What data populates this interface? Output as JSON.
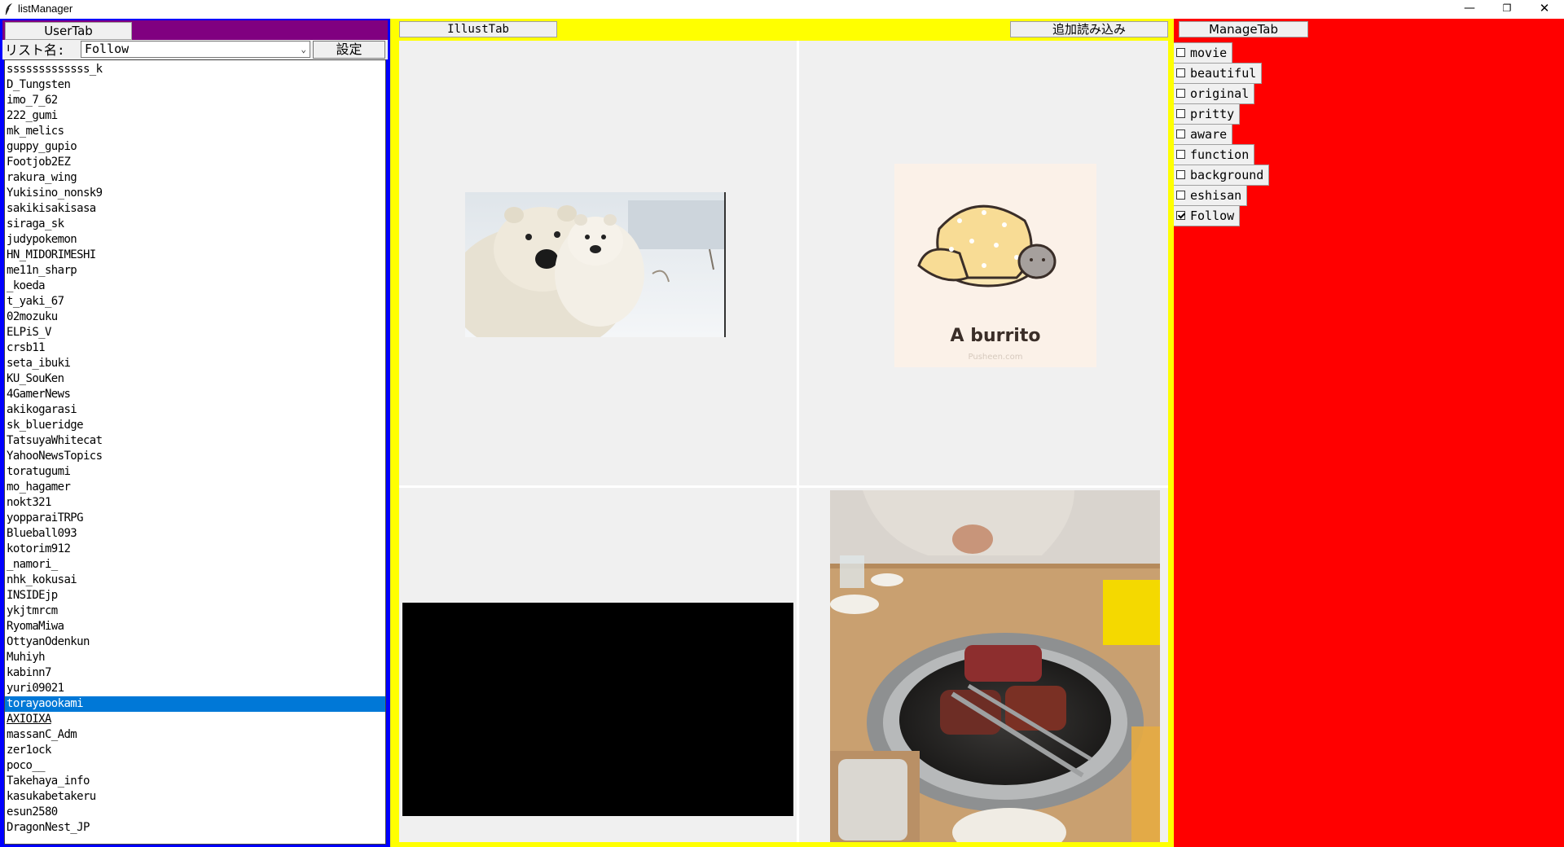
{
  "window": {
    "title": "listManager",
    "minimize": "—",
    "restore": "❐",
    "close": "✕"
  },
  "user_panel": {
    "tab_label": "UserTab",
    "list_label": "リスト名:",
    "list_selected": "Follow",
    "settings_label": "設定",
    "users": [
      "sssssssssssss_k",
      "D_Tungsten",
      "imo_7_62",
      "222_gumi",
      "mk_melics",
      "guppy_gupio",
      "Footjob2EZ",
      "rakura_wing",
      "Yukisino_nonsk9",
      "sakikisakisasa",
      "siraga_sk",
      "judypokemon",
      "HN_MIDORIMESHI",
      "me11n_sharp",
      "_koeda",
      "t_yaki_67",
      "02mozuku",
      "ELPiS_V",
      "crsb11",
      "seta_ibuki",
      "KU_SouKen",
      "4GamerNews",
      "akikogarasi",
      "sk_blueridge",
      "TatsuyaWhitecat",
      "YahooNewsTopics",
      "toratugumi",
      "mo_hagamer",
      "nokt321",
      "yopparaiTRPG",
      "Blueball093",
      "kotorim912",
      "_namori_",
      "nhk_kokusai",
      "INSIDEjp",
      "ykjtmrcm",
      "RyomaMiwa",
      "OttyanOdenkun",
      "Muhiyh",
      "kabinn7",
      "yuri09021",
      "torayaookami",
      "AXIOIXA",
      "massanC_Adm",
      "zer1ock",
      "poco__",
      "Takehaya_info",
      "kasukabetakeru",
      "esun2580",
      "DragonNest_JP"
    ],
    "selected_user": "torayaookami",
    "focused_user": "AXIOIXA"
  },
  "illust_panel": {
    "tab_label": "IllustTab",
    "load_more_label": "追加読み込み",
    "images": [
      {
        "name": "polar-bears-image",
        "caption": ""
      },
      {
        "name": "pusheen-burrito-image",
        "text": "A burrito",
        "credit": "Pusheen.com"
      },
      {
        "name": "black-video-thumbnail"
      },
      {
        "name": "yakiniku-grill-photo"
      }
    ]
  },
  "manage_panel": {
    "tab_label": "ManageTab",
    "tags": [
      {
        "label": "movie",
        "checked": false
      },
      {
        "label": "beautiful",
        "checked": false
      },
      {
        "label": "original",
        "checked": false
      },
      {
        "label": "pritty",
        "checked": false
      },
      {
        "label": "aware",
        "checked": false
      },
      {
        "label": "function",
        "checked": false
      },
      {
        "label": "background",
        "checked": false
      },
      {
        "label": "eshisan",
        "checked": false
      },
      {
        "label": "Follow",
        "checked": true
      }
    ]
  },
  "colors": {
    "user_panel_bg": "#0000ff",
    "user_tabbar_bg": "#800080",
    "illust_panel_bg": "#ffff00",
    "manage_panel_bg": "#ff0000",
    "selection": "#0078d7"
  },
  "icons": {
    "app": "feather-icon",
    "dropdown": "chevron-down-icon"
  }
}
